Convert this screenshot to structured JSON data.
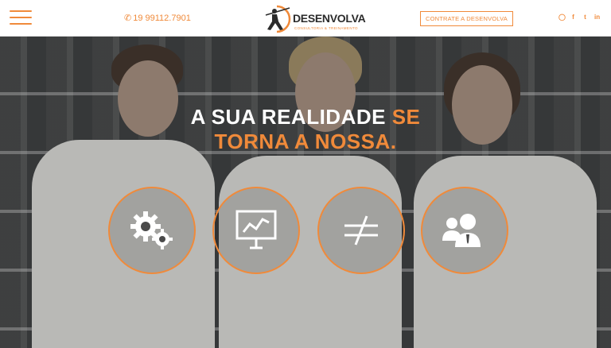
{
  "header": {
    "menu_icon": "hamburger-icon",
    "phone_icon": "phone-icon",
    "phone": "19 99112.7901",
    "logo_brand": "DESENVOLVA",
    "logo_tagline": "CONSULTORIA & TREINAMENTO",
    "cta_label": "CONTRATE A DESENVOLVA",
    "social": [
      "instagram-icon",
      "facebook-icon",
      "twitter-icon",
      "linkedin-icon"
    ],
    "accent_color": "#f08a3a"
  },
  "hero": {
    "headline_part1": "A SUA REALIDADE ",
    "headline_accent1": "SE",
    "headline_accent2": "TORNA A NOSSA.",
    "features": [
      {
        "icon": "gears-icon"
      },
      {
        "icon": "presentation-chart-icon"
      },
      {
        "icon": "not-equal-icon"
      },
      {
        "icon": "team-users-icon"
      }
    ]
  }
}
